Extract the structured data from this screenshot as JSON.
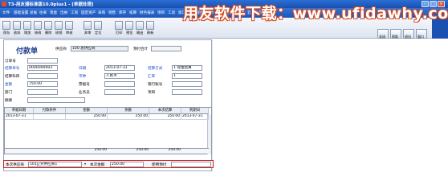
{
  "app": {
    "title": "T3-用友通标准版10.0plus1 - [单据处理]",
    "watermark": "用友软件下载：www.ufidawhy.com"
  },
  "menu": [
    "文件",
    "基础设置",
    "总账",
    "往来",
    "现金",
    "出纳",
    "工资",
    "固定资产",
    "采购",
    "销售",
    "库存",
    "核算",
    "财务报表",
    "项目",
    "工具",
    "窗口",
    "产品服务",
    "帮助",
    "云存·上云",
    "资金",
    "云服务",
    "云华家园"
  ],
  "toolbar": {
    "buttons": [
      "保存",
      "放弃",
      "增加",
      "修改",
      "删除",
      "核销",
      "审核",
      "弃审",
      "定位",
      "打印",
      "预览",
      "输出",
      "刷新"
    ]
  },
  "right_panel": {
    "buttons": [
      "关闭",
      "帮助",
      "退出",
      "窗口"
    ],
    "blue_text": "1.2.3"
  },
  "form": {
    "title": "付款单",
    "supplier_label": "供应商",
    "supplier_value": "100 总供应商",
    "prepay_total_label": "预付合计",
    "prepay_total_value": "",
    "order_no_label": "订单号",
    "order_no_value": "",
    "doc_no_label": "结算单号",
    "doc_no_value": "0000000003",
    "date_label": "日期",
    "date_value": "2013-07-31",
    "settle_method_label": "结算方式",
    "settle_method_value": "1 现金结算",
    "settle_subject_label": "结算科目",
    "settle_subject_value": "",
    "currency_label": "币种",
    "currency_value": "人民币",
    "rate_label": "汇率",
    "rate_value": "1",
    "amount_label": "金额",
    "amount_value": "750.00",
    "bill_no_label": "票据号",
    "bill_no_value": "",
    "bank_acct_label": "银行账号",
    "bank_acct_value": "",
    "dept_label": "部门",
    "dept_value": "",
    "salesman_label": "业务员",
    "salesman_value": "",
    "project_label": "项目",
    "project_value": "",
    "summary_label": "摘要",
    "summary_value": ""
  },
  "grid": {
    "headers": [
      "单据日期",
      "付款条件",
      "金额",
      "余额",
      "本次结算",
      "到期日"
    ],
    "rows": [
      [
        "2013-07-31",
        "",
        "250.00",
        "250.00",
        "250.00",
        "2013-07-31"
      ]
    ],
    "sum": [
      "",
      "",
      "250.00",
      "250.00",
      "250.00",
      ""
    ]
  },
  "bottom_bar": {
    "label1": "本次供应商",
    "supplier_code": "101",
    "supplier_name": "分供应商1",
    "label2": "本次金额",
    "amount": "250.00",
    "label3": "使用预付",
    "prepay": ""
  }
}
